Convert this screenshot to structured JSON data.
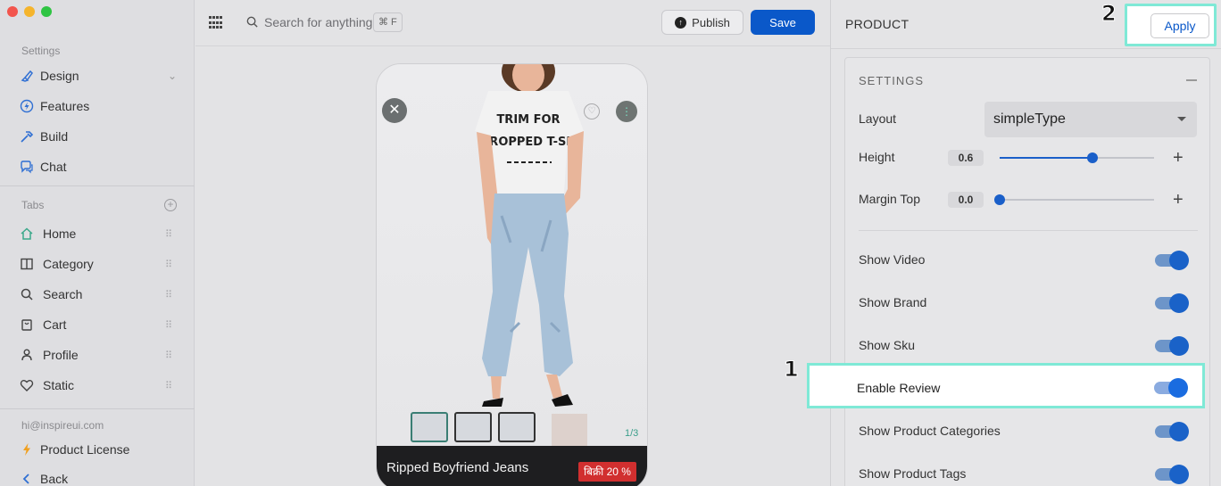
{
  "sidebar": {
    "settings_label": "Settings",
    "settings_items": [
      {
        "label": "Design",
        "icon": "brush-icon"
      },
      {
        "label": "Features",
        "icon": "lightning-icon"
      },
      {
        "label": "Build",
        "icon": "hammer-icon"
      },
      {
        "label": "Chat",
        "icon": "chat-icon"
      }
    ],
    "tabs_label": "Tabs",
    "tab_items": [
      {
        "label": "Home",
        "icon": "home-icon"
      },
      {
        "label": "Category",
        "icon": "book-icon"
      },
      {
        "label": "Search",
        "icon": "search-icon"
      },
      {
        "label": "Cart",
        "icon": "cart-icon"
      },
      {
        "label": "Profile",
        "icon": "person-icon"
      },
      {
        "label": "Static",
        "icon": "heart-icon"
      }
    ],
    "email": "hi@inspireui.com",
    "license_label": "Product License",
    "back_label": "Back"
  },
  "topbar": {
    "search_placeholder": "Search for anything",
    "shortcut": "⌘ F",
    "publish_label": "Publish",
    "save_label": "Save"
  },
  "preview": {
    "product_name": "Ripped Boyfriend Jeans",
    "sale_badge": "बिक्री 20 %",
    "image_counter": "1/3",
    "shirt_text_line1": "TRIM FOR",
    "shirt_text_line2": "CROPPED T-SH"
  },
  "panel": {
    "title": "PRODUCT",
    "apply_label": "Apply",
    "step_apply": "2",
    "step_review": "1",
    "settings_title": "SETTINGS",
    "layout_label": "Layout",
    "layout_value": "simpleType",
    "height_label": "Height",
    "height_value": "0.6",
    "margin_label": "Margin Top",
    "margin_value": "0.0",
    "toggles": [
      {
        "label": "Show Video",
        "on": true
      },
      {
        "label": "Show Brand",
        "on": true
      },
      {
        "label": "Show Sku",
        "on": true
      },
      {
        "label": "Enable Review",
        "on": true
      },
      {
        "label": "Show Product Categories",
        "on": true
      },
      {
        "label": "Show Product Tags",
        "on": true
      }
    ]
  },
  "colors": {
    "accent": "#0a58c9",
    "highlight": "#7fe9d6",
    "sale": "#d12f2f"
  }
}
